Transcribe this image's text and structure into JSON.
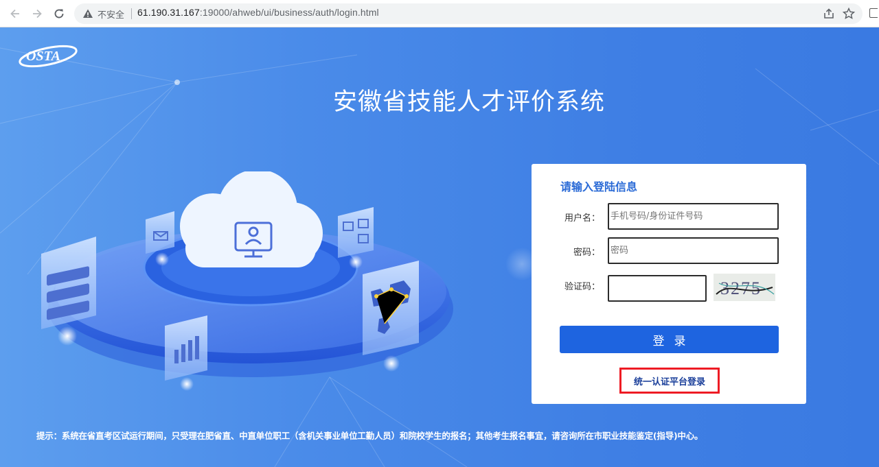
{
  "browser": {
    "security_label": "不安全",
    "url_host": "61.190.31.167",
    "url_path": ":19000/ahweb/ui/business/auth/login.html",
    "icons": [
      "back-arrow-icon",
      "forward-arrow-icon",
      "reload-icon",
      "warning-icon",
      "share-icon",
      "star-icon"
    ]
  },
  "header": {
    "logo_text": "OSTA",
    "title": "安徽省技能人才评价系统"
  },
  "login": {
    "heading": "请输入登陆信息",
    "username_label": "用户名：",
    "username_placeholder": "手机号码/身份证件号码",
    "password_label": "密码：",
    "password_placeholder": "密码",
    "captcha_label": "验证码：",
    "captcha_text": "3275",
    "submit_label": "登录",
    "unified_login_label": "统一认证平台登录"
  },
  "footer": {
    "notice": "提示：系统在省直考区试运行期间，只受理在肥省直、中直单位职工（含机关事业单位工勤人员）和院校学生的报名；其他考生报名事宜，请咨询所在市职业技能鉴定(指导)中心。"
  },
  "colors": {
    "page_bg": "#4a8be9",
    "primary_button": "#1e64e0",
    "heading_blue": "#2a6ad6",
    "highlight_red": "#ee1b24"
  }
}
